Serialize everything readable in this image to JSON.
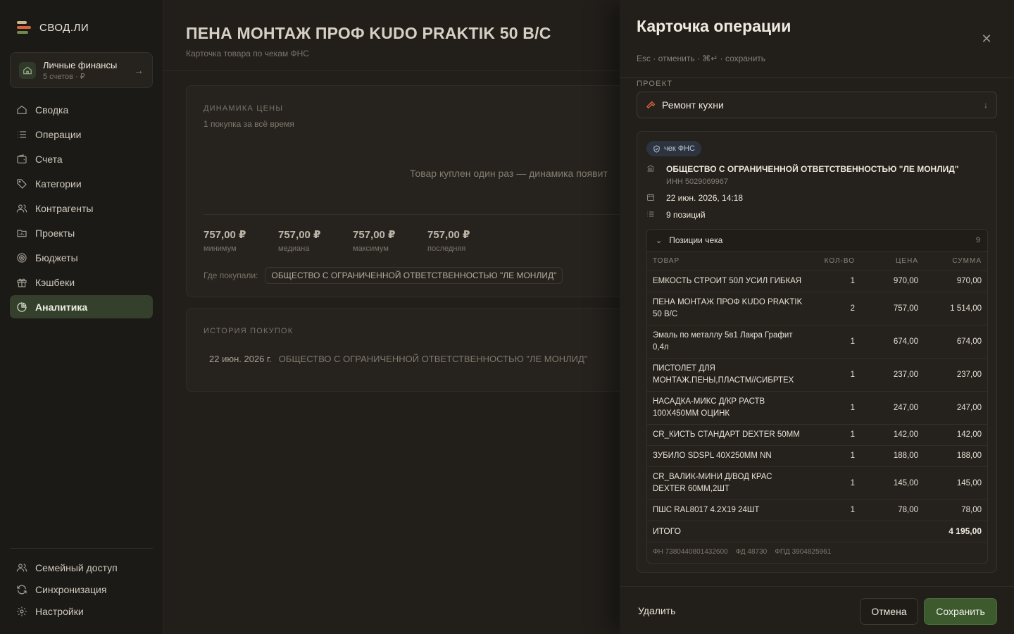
{
  "app": {
    "name": "СВОД.ЛИ"
  },
  "account": {
    "name": "Личные финансы",
    "sub": "5 счетов · ₽"
  },
  "nav": [
    {
      "label": "Сводка",
      "icon": "home-icon"
    },
    {
      "label": "Операции",
      "icon": "list-icon"
    },
    {
      "label": "Счета",
      "icon": "wallet-icon"
    },
    {
      "label": "Категории",
      "icon": "tag-icon"
    },
    {
      "label": "Контрагенты",
      "icon": "users-icon"
    },
    {
      "label": "Проекты",
      "icon": "folder-icon"
    },
    {
      "label": "Бюджеты",
      "icon": "target-icon"
    },
    {
      "label": "Кэшбеки",
      "icon": "gift-icon"
    },
    {
      "label": "Аналитика",
      "icon": "pie-chart-icon"
    }
  ],
  "bottom_nav": [
    {
      "label": "Семейный доступ",
      "icon": "users-icon"
    },
    {
      "label": "Синхронизация",
      "icon": "sync-icon"
    },
    {
      "label": "Настройки",
      "icon": "gear-icon"
    }
  ],
  "product": {
    "title": "ПЕНА МОНТАЖ ПРОФ KUDO PRAKTIK 50 В/С",
    "subtitle": "Карточка товара по чекам ФНС",
    "price_dynamics": {
      "label": "ДИНАМИКА ЦЕНЫ",
      "sub": "1 покупка за всё время",
      "empty": "Товар куплен один раз — динамика появит",
      "stats": [
        {
          "value": "757,00 ₽",
          "label": "минимум"
        },
        {
          "value": "757,00 ₽",
          "label": "медиана"
        },
        {
          "value": "757,00 ₽",
          "label": "максимум"
        },
        {
          "value": "757,00 ₽",
          "label": "последняя"
        }
      ],
      "where_label": "Где покупали:",
      "where_chip": "ОБЩЕСТВО С ОГРАНИЧЕННОЙ ОТВЕТСТВЕННОСТЬЮ \"ЛЕ МОНЛИД\""
    },
    "history": {
      "label": "ИСТОРИЯ ПОКУПОК",
      "rows": [
        {
          "date": "22 июн. 2026 г.",
          "vendor": "ОБЩЕСТВО С ОГРАНИЧЕННОЙ ОТВЕТСТВЕННОСТЬЮ \"ЛЕ МОНЛИД\""
        }
      ]
    }
  },
  "drawer": {
    "title": "Карточка операции",
    "hint": "Esc · отменить · ⌘↵ · сохранить",
    "project_label": "ПРОЕКТ",
    "project_value": "Ремонт кухни",
    "badge": "чек ФНС",
    "vendor": "ОБЩЕСТВО С ОГРАНИЧЕННОЙ ОТВЕТСТВЕННОСТЬЮ \"ЛЕ МОНЛИД\"",
    "inn": "ИНН 5029069967",
    "datetime": "22 июн. 2026, 14:18",
    "positions_count": "9 позиций",
    "items": {
      "title": "Позиции чека",
      "count": "9",
      "headers": {
        "name": "ТОВАР",
        "qty": "КОЛ-ВО",
        "price": "ЦЕНА",
        "sum": "СУММА"
      },
      "rows": [
        {
          "name": "ЕМКОСТЬ СТРОИТ 50Л УСИЛ ГИБКАЯ",
          "qty": "1",
          "price": "970,00",
          "sum": "970,00"
        },
        {
          "name": "ПЕНА МОНТАЖ ПРОФ KUDO PRAKTIK 50 В/С",
          "qty": "2",
          "price": "757,00",
          "sum": "1 514,00"
        },
        {
          "name": "Эмаль по металлу 5в1 Лакра Графит 0,4л",
          "qty": "1",
          "price": "674,00",
          "sum": "674,00"
        },
        {
          "name": "ПИСТОЛЕТ ДЛЯ МОНТАЖ.ПЕНЫ,ПЛАСТМ//СИБРТЕХ",
          "qty": "1",
          "price": "237,00",
          "sum": "237,00"
        },
        {
          "name": "НАСАДКА-МИКС Д/КР РАСТВ 100Х450ММ ОЦИНК",
          "qty": "1",
          "price": "247,00",
          "sum": "247,00"
        },
        {
          "name": "CR_КИСТЬ СТАНДАРТ DEXTER 50ММ",
          "qty": "1",
          "price": "142,00",
          "sum": "142,00"
        },
        {
          "name": "ЗУБИЛО SDSPL 40Х250ММ NN",
          "qty": "1",
          "price": "188,00",
          "sum": "188,00"
        },
        {
          "name": "CR_ВАЛИК-МИНИ Д/ВОД КРАС DEXTER 60ММ,2ШТ",
          "qty": "1",
          "price": "145,00",
          "sum": "145,00"
        },
        {
          "name": "ПШС RAL8017 4.2Х19 24ШТ",
          "qty": "1",
          "price": "78,00",
          "sum": "78,00"
        }
      ],
      "total_label": "ИТОГО",
      "total_value": "4 195,00",
      "fiscal": {
        "fn": "ФН 7380440801432600",
        "fd": "ФД 48730",
        "fpd": "ФПД 3904825961"
      }
    },
    "buttons": {
      "delete": "Удалить",
      "cancel": "Отмена",
      "save": "Сохранить"
    }
  },
  "colors": {
    "accent": "#3c5a2e",
    "active_nav": "#34402c",
    "badge_bg": "#2d3440"
  }
}
